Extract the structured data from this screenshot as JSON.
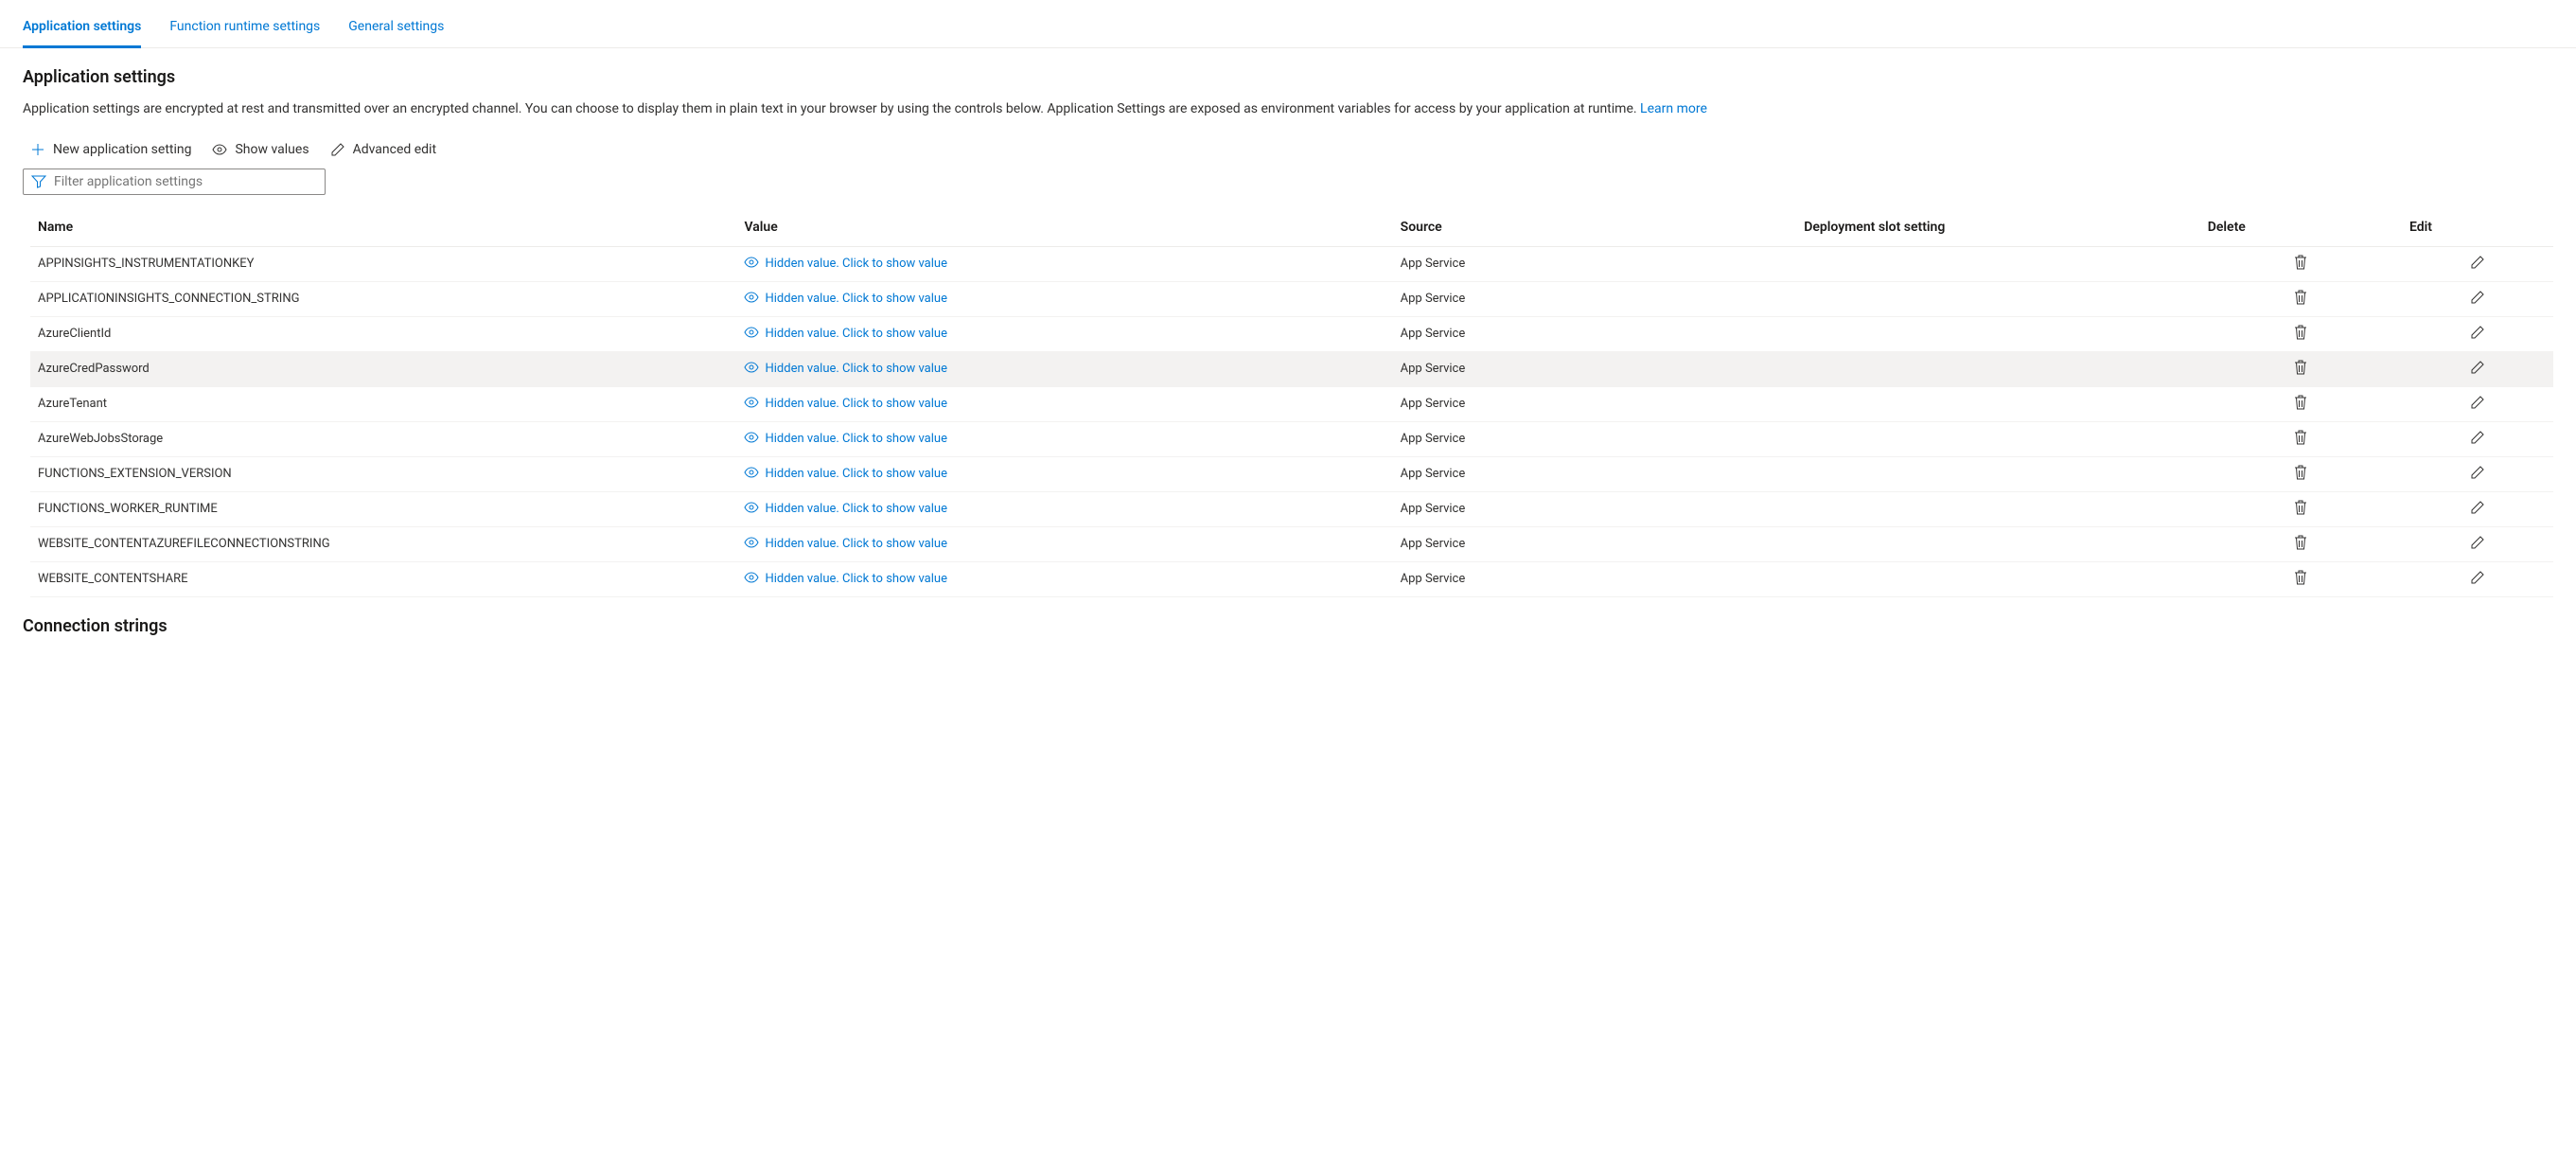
{
  "tabs": [
    {
      "label": "Application settings",
      "active": true
    },
    {
      "label": "Function runtime settings",
      "active": false
    },
    {
      "label": "General settings",
      "active": false
    }
  ],
  "section": {
    "title": "Application settings",
    "description": "Application settings are encrypted at rest and transmitted over an encrypted channel. You can choose to display them in plain text in your browser by using the controls below. Application Settings are exposed as environment variables for access by your application at runtime. ",
    "learn_more": "Learn more"
  },
  "toolbar": {
    "new_setting": "New application setting",
    "show_values": "Show values",
    "advanced_edit": "Advanced edit"
  },
  "filter": {
    "placeholder": "Filter application settings"
  },
  "table": {
    "columns": {
      "name": "Name",
      "value": "Value",
      "source": "Source",
      "deployment": "Deployment slot setting",
      "delete": "Delete",
      "edit": "Edit"
    },
    "hidden_value_text": "Hidden value. Click to show value",
    "rows": [
      {
        "name": "APPINSIGHTS_INSTRUMENTATIONKEY",
        "source": "App Service",
        "hover": false
      },
      {
        "name": "APPLICATIONINSIGHTS_CONNECTION_STRING",
        "source": "App Service",
        "hover": false
      },
      {
        "name": "AzureClientId",
        "source": "App Service",
        "hover": false
      },
      {
        "name": "AzureCredPassword",
        "source": "App Service",
        "hover": true
      },
      {
        "name": "AzureTenant",
        "source": "App Service",
        "hover": false
      },
      {
        "name": "AzureWebJobsStorage",
        "source": "App Service",
        "hover": false
      },
      {
        "name": "FUNCTIONS_EXTENSION_VERSION",
        "source": "App Service",
        "hover": false
      },
      {
        "name": "FUNCTIONS_WORKER_RUNTIME",
        "source": "App Service",
        "hover": false
      },
      {
        "name": "WEBSITE_CONTENTAZUREFILECONNECTIONSTRING",
        "source": "App Service",
        "hover": false
      },
      {
        "name": "WEBSITE_CONTENTSHARE",
        "source": "App Service",
        "hover": false
      }
    ]
  },
  "connection_strings": {
    "title": "Connection strings"
  }
}
